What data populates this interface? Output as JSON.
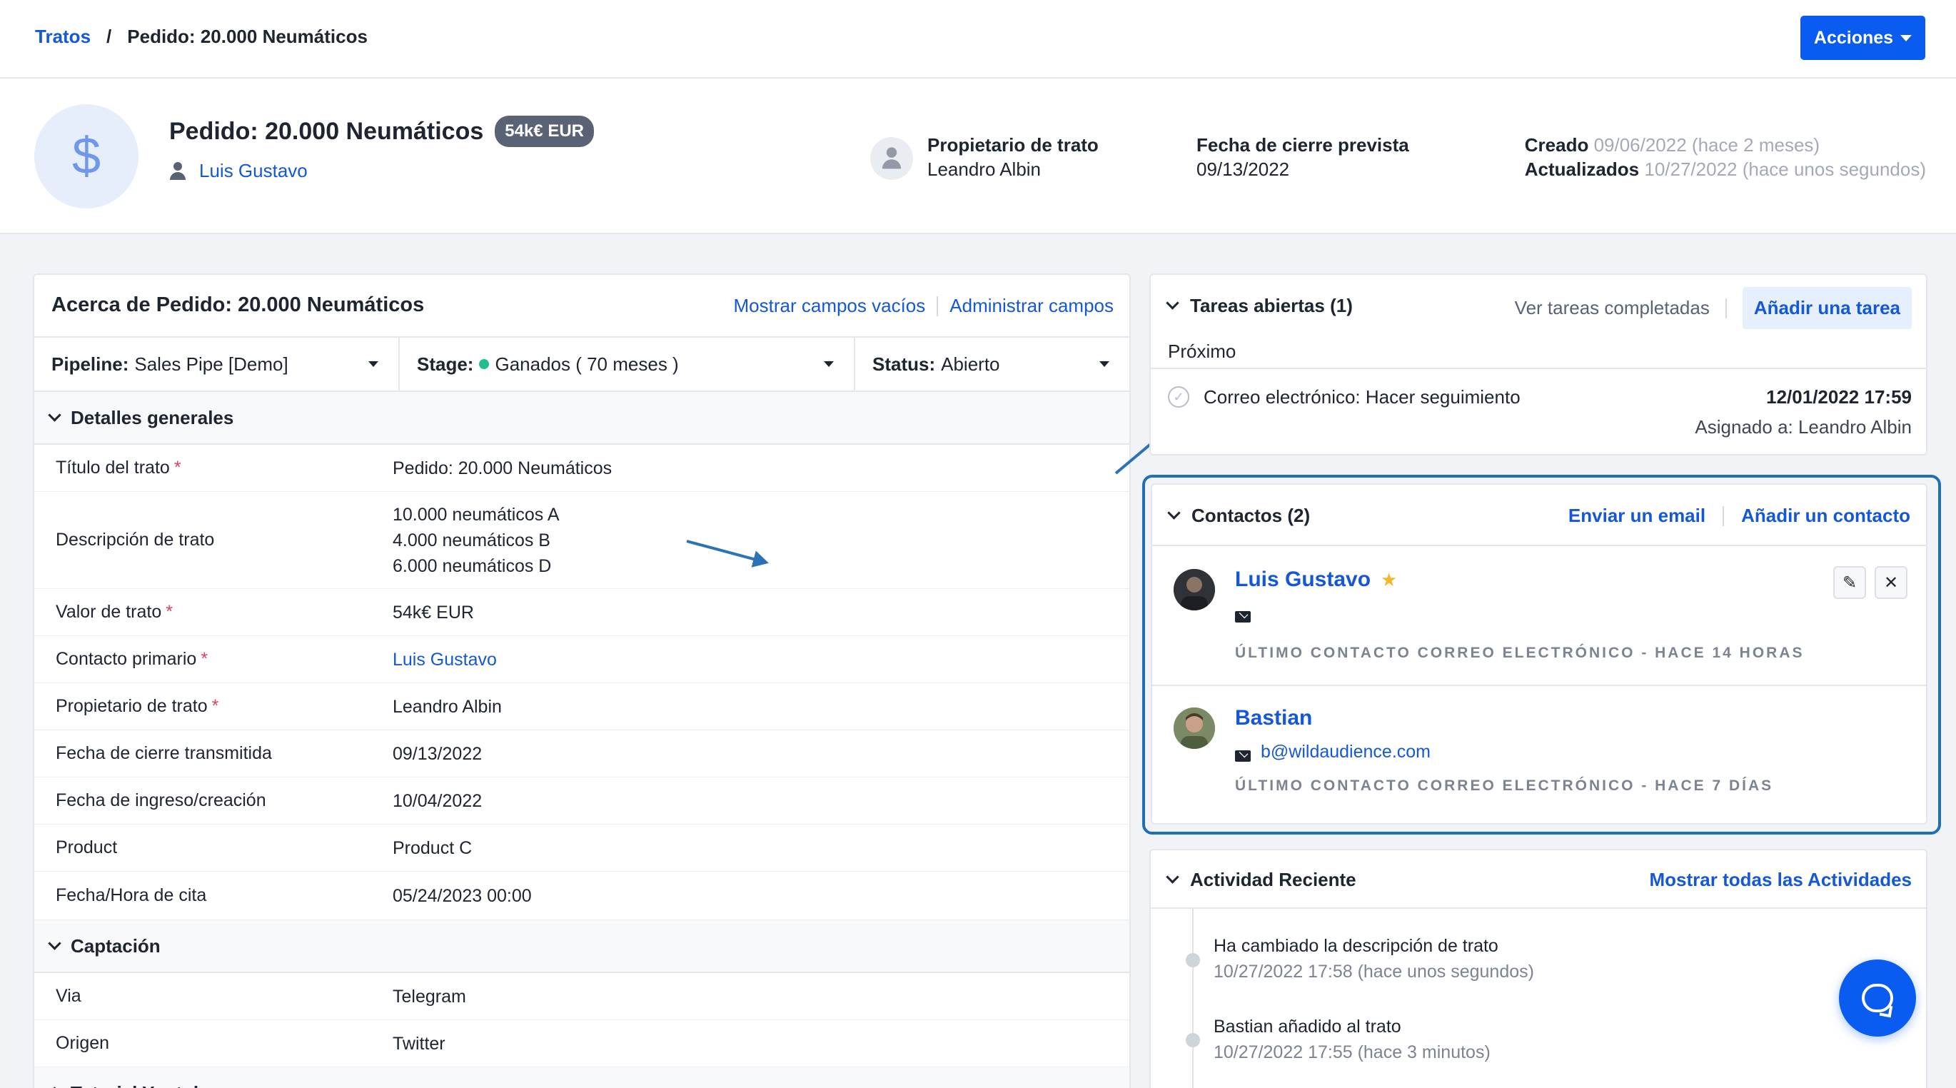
{
  "breadcrumb": {
    "root": "Tratos",
    "separator": "/",
    "current": "Pedido: 20.000 Neumáticos"
  },
  "actions_button": "Acciones",
  "deal": {
    "icon": "dollar-icon",
    "title": "Pedido: 20.000 Neumáticos",
    "value_badge": "54k€ EUR",
    "contact_name": "Luis Gustavo",
    "owner_label": "Propietario de trato",
    "owner_name": "Leandro Albin",
    "close_label": "Fecha de cierre prevista",
    "close_date": "09/13/2022",
    "created_label": "Creado",
    "created_value": "09/06/2022 (hace 2 meses)",
    "updated_label": "Actualizados",
    "updated_value": "10/27/2022 (hace unos segundos)"
  },
  "about": {
    "title": "Acerca de Pedido: 20.000 Neumáticos",
    "show_empty": "Mostrar campos vacíos",
    "manage_fields": "Administrar campos",
    "pipeline_label": "Pipeline:",
    "pipeline_value": "Sales Pipe [Demo]",
    "stage_label": "Stage:",
    "stage_value": "Ganados ( 70 meses )",
    "status_label": "Status:",
    "status_value": "Abierto",
    "stage_color": "#1fbf8f",
    "section_general": "Detalles generales",
    "fields": [
      {
        "label": "Título del trato",
        "required": true,
        "value": "Pedido: 20.000 Neumáticos"
      },
      {
        "label": "Descripción de trato",
        "required": false,
        "value_lines": [
          "10.000 neumáticos A",
          "4.000 neumáticos B",
          "6.000 neumáticos D"
        ]
      },
      {
        "label": "Valor de trato",
        "required": true,
        "value": "54k€ EUR"
      },
      {
        "label": "Contacto primario",
        "required": true,
        "value": "Luis Gustavo"
      },
      {
        "label": "Propietario de trato",
        "required": true,
        "value": "Leandro Albin"
      },
      {
        "label": "Fecha de cierre transmitida",
        "required": false,
        "value": "09/13/2022"
      },
      {
        "label": "Fecha de ingreso/creación",
        "required": false,
        "value": "10/04/2022"
      },
      {
        "label": "Product",
        "required": false,
        "value": "Product C"
      },
      {
        "label": "Fecha/Hora de cita",
        "required": false,
        "value": "05/24/2023 00:00"
      }
    ],
    "required_mark": "*",
    "section_captacion": "Captación",
    "captacion_fields": [
      {
        "label": "Via",
        "value": "Telegram"
      },
      {
        "label": "Origen",
        "value": "Twitter"
      }
    ],
    "section_next": "Tutorial Youtube"
  },
  "tasks": {
    "title": "Tareas abiertas (1)",
    "view_completed": "Ver tareas completadas",
    "add_task": "Añadir una tarea",
    "next_label": "Próximo",
    "items": [
      {
        "title": "Correo electrónico: Hacer seguimiento",
        "date": "12/01/2022 17:59",
        "assigned": "Asignado a: Leandro Albin"
      }
    ]
  },
  "contacts": {
    "title": "Contactos (2)",
    "send_email": "Enviar un email",
    "add_contact": "Añadir un contacto",
    "items": [
      {
        "name": "Luis Gustavo",
        "starred": true,
        "email": "",
        "last_contact": "ÚLTIMO CONTACTO CORREO ELECTRÓNICO - HACE 14 HORAS"
      },
      {
        "name": "Bastian",
        "starred": false,
        "email": "b@wildaudience.com",
        "last_contact": "ÚLTIMO CONTACTO CORREO ELECTRÓNICO - HACE 7 DÍAS"
      }
    ]
  },
  "activity": {
    "title": "Actividad Reciente",
    "show_all": "Mostrar todas las Actividades",
    "items": [
      {
        "text": "Ha cambiado la descripción de trato",
        "time": "10/27/2022 17:58 (hace unos segundos)"
      },
      {
        "text": "Bastian añadido al trato",
        "time": "10/27/2022 17:55 (hace 3 minutos)"
      }
    ]
  },
  "colors": {
    "accent": "#0a5bf0",
    "link": "#1458d9",
    "highlight_outline": "#1e6fb8",
    "required": "#e04163"
  }
}
